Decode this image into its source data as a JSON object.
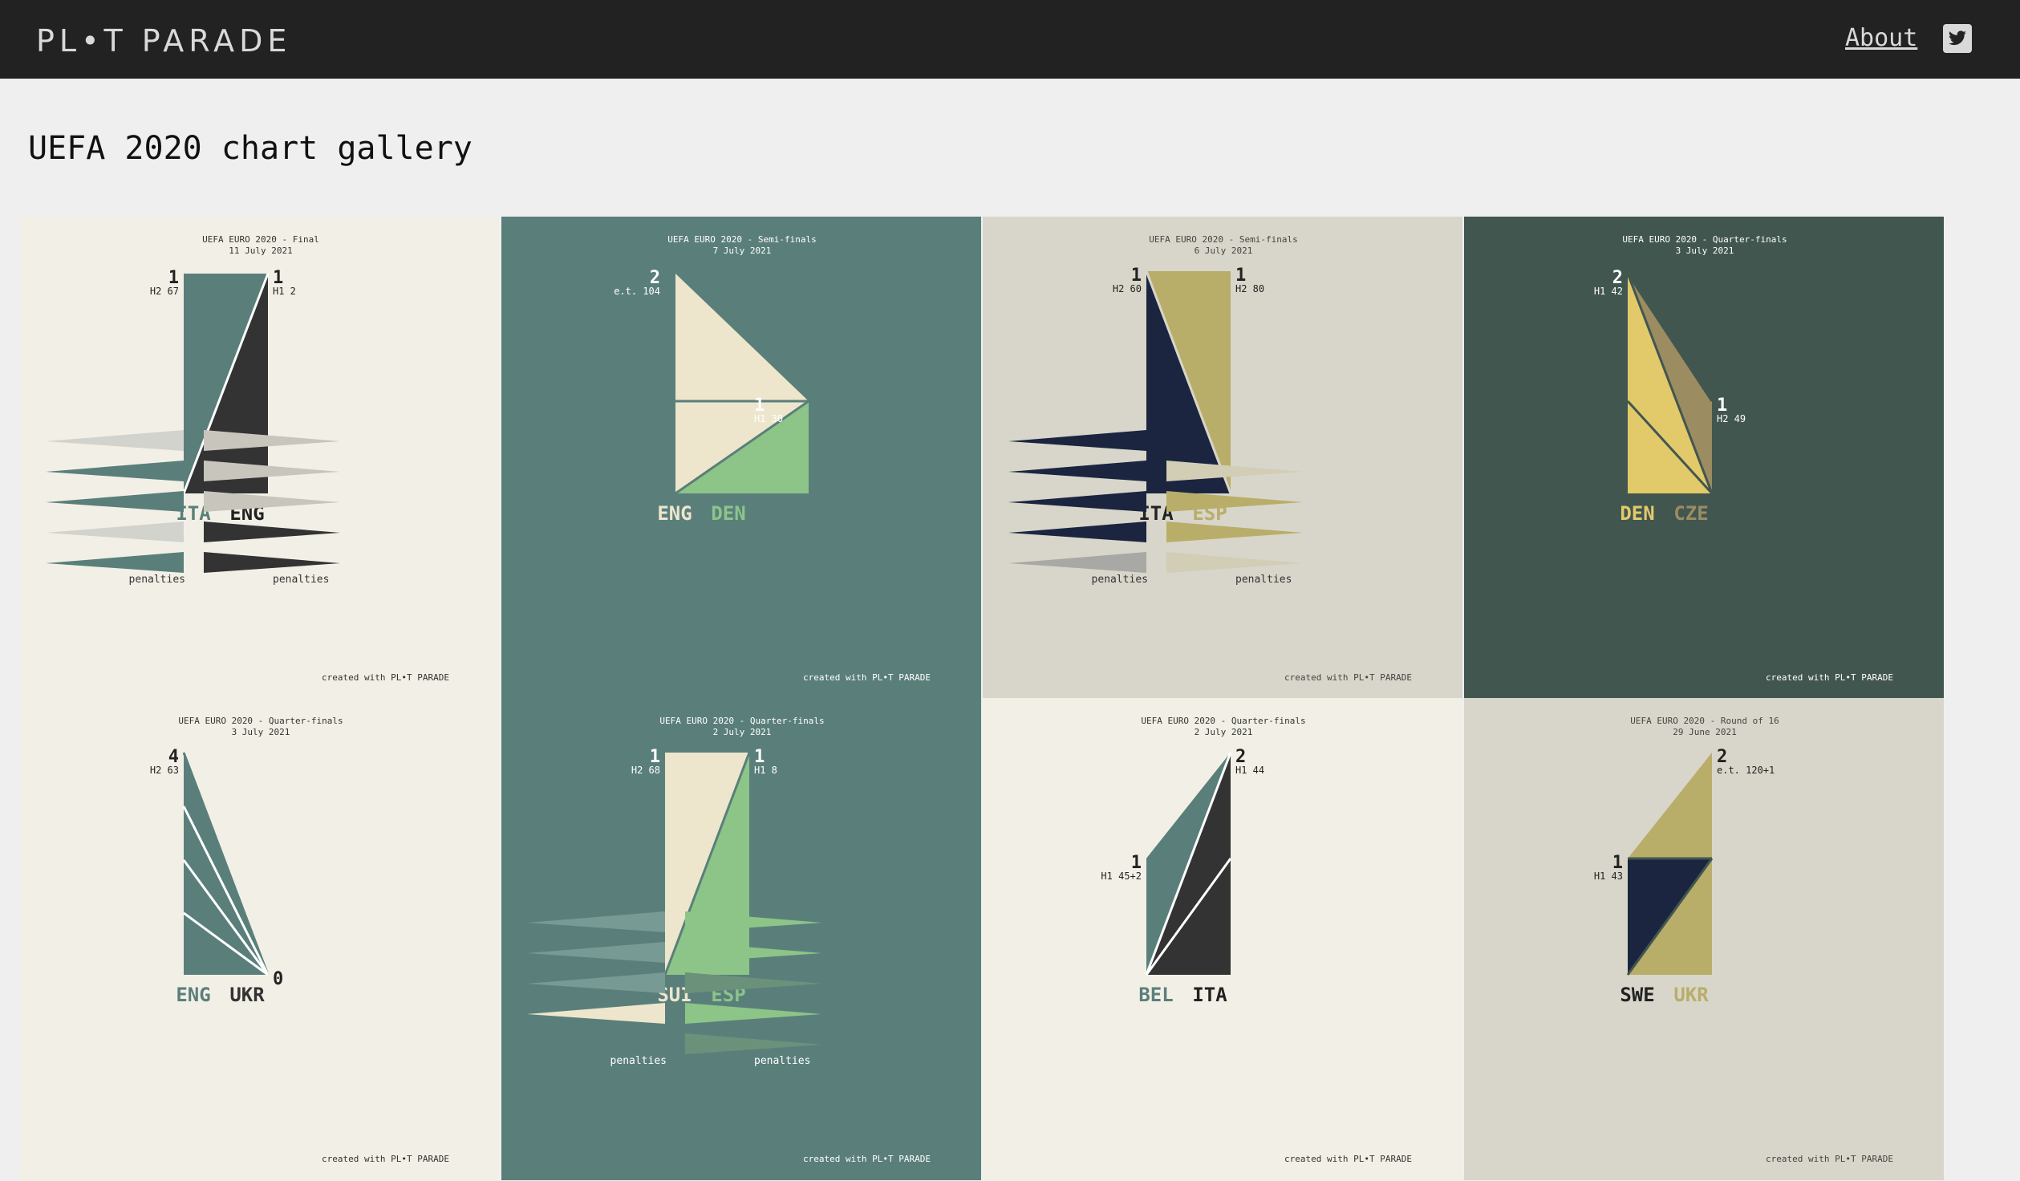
{
  "app": {
    "logo_text": "PL•T PARADE",
    "nav_about": "About",
    "twitter_icon": "twitter-icon"
  },
  "page": {
    "title": "UEFA 2020 chart gallery"
  },
  "colors": {
    "topbar": "#222222",
    "page_bg": "#efefef",
    "teal": "#5a7f7b",
    "dark": "#333333",
    "cream": "#f2f0e6",
    "green": "#8dc488",
    "light_cream": "#ede6cc",
    "navy": "#1b2540",
    "khaki": "#b9ad6a",
    "gray_beige": "#d6d4c8",
    "dark_green": "#425650",
    "yellow": "#e2c96a",
    "olive_brown": "#9c8c62"
  },
  "cards": [
    {
      "title": "UEFA EURO 2020 - Final",
      "date": "11 July 2021",
      "home": "ITA",
      "away": "ENG",
      "home_score": "1",
      "home_note": "H2 67",
      "away_score": "1",
      "away_note": "H1 2",
      "home_pen_label": "penalties",
      "away_pen_label": "penalties",
      "credit": "created with PL•T PARADE",
      "home_pens": [
        0,
        1,
        1,
        0,
        1
      ],
      "away_pens": [
        0,
        0,
        0,
        1,
        1
      ]
    },
    {
      "title": "UEFA EURO 2020 - Semi-finals",
      "date": "7 July 2021",
      "home": "ENG",
      "away": "DEN",
      "home_score": "2",
      "home_note": "e.t. 104",
      "away_score": "1",
      "away_note": "H1 30",
      "credit": "created with PL•T PARADE"
    },
    {
      "title": "UEFA EURO 2020 - Semi-finals",
      "date": "6 July 2021",
      "home": "ITA",
      "away": "ESP",
      "home_score": "1",
      "home_note": "H2 60",
      "away_score": "1",
      "away_note": "H2 80",
      "home_pen_label": "penalties",
      "away_pen_label": "penalties",
      "credit": "created with PL•T PARADE",
      "home_pens": [
        1,
        1,
        1,
        1,
        0
      ],
      "away_pens": [
        0,
        1,
        1,
        0
      ]
    },
    {
      "title": "UEFA EURO 2020 - Quarter-finals",
      "date": "3 July 2021",
      "home": "DEN",
      "away": "CZE",
      "home_score": "2",
      "home_note": "H1 42",
      "away_score": "1",
      "away_note": "H2 49",
      "credit": "created with PL•T PARADE"
    },
    {
      "title": "UEFA EURO 2020 - Quarter-finals",
      "date": "3 July 2021",
      "home": "ENG",
      "away": "UKR",
      "home_score": "4",
      "home_note": "H2 63",
      "away_score": "0",
      "credit": "created with PL•T PARADE"
    },
    {
      "title": "UEFA EURO 2020 - Quarter-finals",
      "date": "2 July 2021",
      "home": "SUI",
      "away": "ESP",
      "home_score": "1",
      "home_note": "H2 68",
      "away_score": "1",
      "away_note": "H1 8",
      "home_pen_label": "penalties",
      "away_pen_label": "penalties",
      "credit": "created with PL•T PARADE",
      "home_pens": [
        0,
        0,
        0,
        1
      ],
      "away_pens": [
        1,
        1,
        0,
        1,
        0
      ]
    },
    {
      "title": "UEFA EURO 2020 - Quarter-finals",
      "date": "2 July 2021",
      "home": "BEL",
      "away": "ITA",
      "home_score": "1",
      "home_note": "H1 45+2",
      "away_score": "2",
      "away_note": "H1 44",
      "credit": "created with PL•T PARADE"
    },
    {
      "title": "UEFA EURO 2020 - Round of 16",
      "date": "29 June 2021",
      "home": "SWE",
      "away": "UKR",
      "home_score": "1",
      "home_note": "H1 43",
      "away_score": "2",
      "away_note": "e.t. 120+1",
      "credit": "created with PL•T PARADE"
    }
  ]
}
